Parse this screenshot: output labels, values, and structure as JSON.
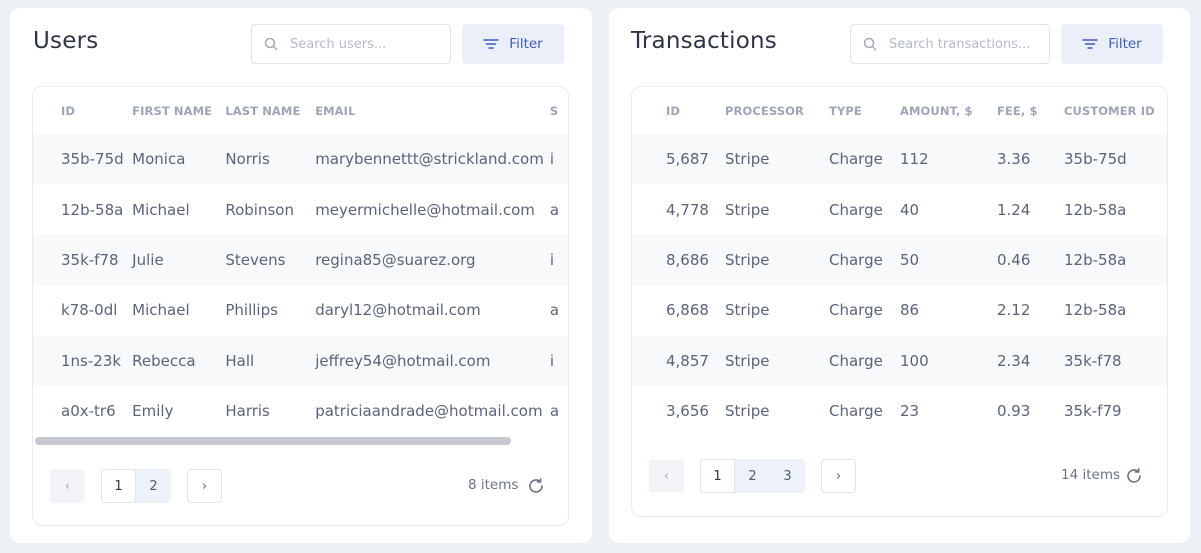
{
  "users": {
    "title": "Users",
    "search_placeholder": "Search users...",
    "filter_label": "Filter",
    "columns": [
      "ID",
      "FIRST NAME",
      "LAST NAME",
      "EMAIL",
      "S"
    ],
    "rows": [
      [
        "35b-75d",
        "Monica",
        "Norris",
        "marybennettt@strickland.com",
        "i"
      ],
      [
        "12b-58a",
        "Michael",
        "Robinson",
        "meyermichelle@hotmail.com",
        "a"
      ],
      [
        "35k-f78",
        "Julie",
        "Stevens",
        "regina85@suarez.org",
        "i"
      ],
      [
        "k78-0dl",
        "Michael",
        "Phillips",
        "daryl12@hotmail.com",
        "a"
      ],
      [
        "1ns-23k",
        "Rebecca",
        "Hall",
        "jeffrey54@hotmail.com",
        "i"
      ],
      [
        "a0x-tr6",
        "Emily",
        "Harris",
        "patriciaandrade@hotmail.com",
        "a"
      ]
    ],
    "pages": [
      "1",
      "2"
    ],
    "active_page": "1",
    "prev_label": "‹",
    "next_label": "›",
    "items_count": "8 items"
  },
  "transactions": {
    "title": "Transactions",
    "search_placeholder": "Search transactions...",
    "filter_label": "Filter",
    "columns": [
      "ID",
      "PROCESSOR",
      "TYPE",
      "AMOUNT, $",
      "FEE, $",
      "CUSTOMER ID"
    ],
    "rows": [
      [
        "5,687",
        "Stripe",
        "Charge",
        "112",
        "3.36",
        "35b-75d"
      ],
      [
        "4,778",
        "Stripe",
        "Charge",
        "40",
        "1.24",
        "12b-58a"
      ],
      [
        "8,686",
        "Stripe",
        "Charge",
        "50",
        "0.46",
        "12b-58a"
      ],
      [
        "6,868",
        "Stripe",
        "Charge",
        "86",
        "2.12",
        "12b-58a"
      ],
      [
        "4,857",
        "Stripe",
        "Charge",
        "100",
        "2.34",
        "35k-f78"
      ],
      [
        "3,656",
        "Stripe",
        "Charge",
        "23",
        "0.93",
        "35k-f79"
      ]
    ],
    "pages": [
      "1",
      "2",
      "3"
    ],
    "active_page": "1",
    "prev_label": "‹",
    "next_label": "›",
    "items_count": "14 items"
  },
  "icons": {
    "search": "search-icon",
    "filter": "filter-lines-icon",
    "refresh": "refresh-icon"
  },
  "colors": {
    "background": "#edf0f5",
    "accent": "#3e5bb7",
    "filter_bg": "#eaeffa",
    "row_stripe": "#f7f9fb"
  }
}
